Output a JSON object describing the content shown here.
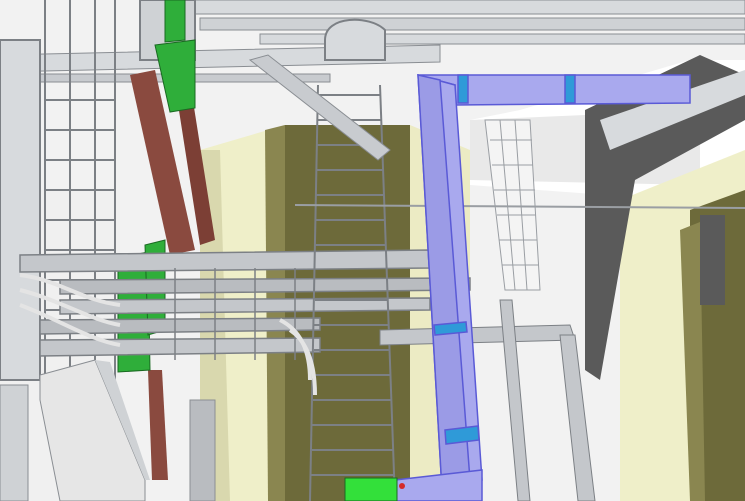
{
  "scene": {
    "subject": "3d-plant-model-cable-trays",
    "colors": {
      "background": "#ffffff",
      "tray_gray": "#b9bcc0",
      "tray_edge": "#8a8e93",
      "pipe_light": "#d7dadd",
      "olive_pit": "#6d6a3a",
      "cream_wall": "#efefc9",
      "blue_duct": "#a9a9ee",
      "blue_duct_edge": "#5a5ad6",
      "blue_band": "#2f9ad8",
      "green_support": "#2fae3a",
      "green_bright": "#33e03a",
      "brown_beam": "#8a4a3f",
      "dark_column": "#5a5a5a",
      "wall_panel": "#e6e6e6"
    }
  }
}
